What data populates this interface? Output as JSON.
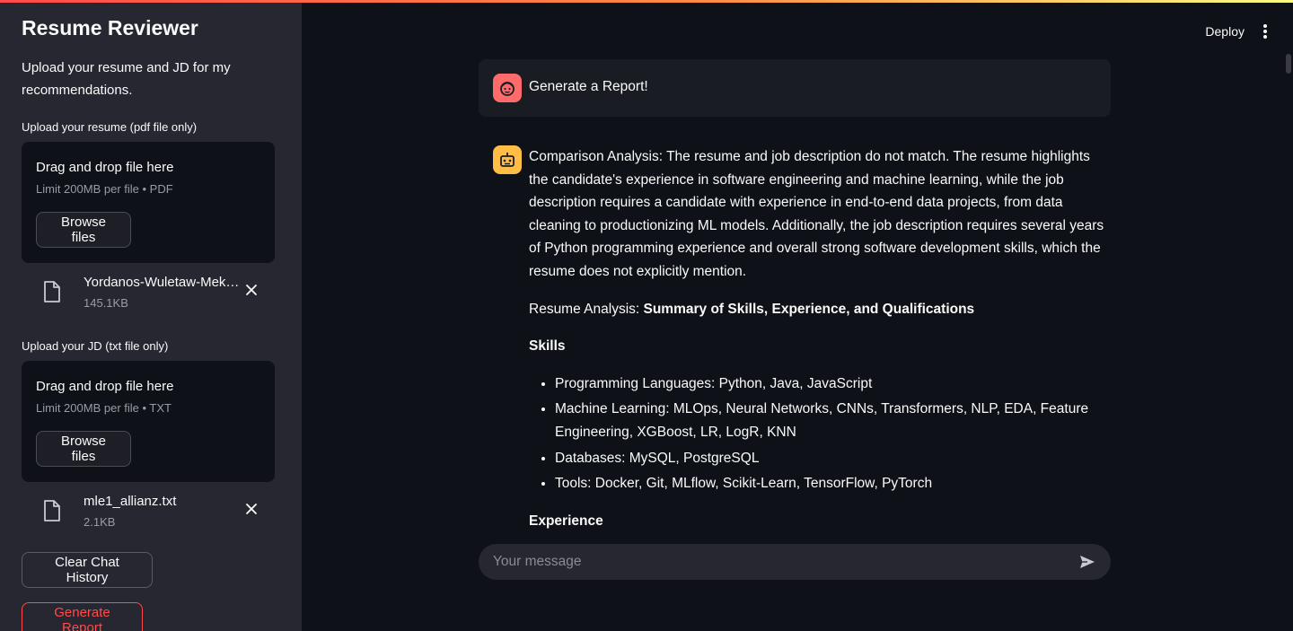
{
  "sidebar": {
    "title": "Resume Reviewer",
    "description": "Upload your resume and JD for my recommendations.",
    "resume_upload": {
      "label": "Upload your resume (pdf file only)",
      "drop_text": "Drag and drop file here",
      "limit_text": "Limit 200MB per file • PDF",
      "browse_label": "Browse files",
      "file": {
        "name": "Yordanos-Wuletaw-Mek…",
        "size": "145.1KB"
      }
    },
    "jd_upload": {
      "label": "Upload your JD (txt file only)",
      "drop_text": "Drag and drop file here",
      "limit_text": "Limit 200MB per file • TXT",
      "browse_label": "Browse files",
      "file": {
        "name": "mle1_allianz.txt",
        "size": "2.1KB"
      }
    },
    "clear_label": "Clear Chat History",
    "generate_label": "Generate Report"
  },
  "header": {
    "deploy_label": "Deploy",
    "menu_icon": "kebab-menu-icon"
  },
  "chat": {
    "user_message": "Generate a Report!",
    "bot_message": {
      "comparison": "Comparison Analysis: The resume and job description do not match. The resume highlights the candidate's experience in software engineering and machine learning, while the job description requires a candidate with experience in end-to-end data projects, from data cleaning to productionizing ML models. Additionally, the job description requires several years of Python programming experience and overall strong software development skills, which the resume does not explicitly mention.",
      "resume_analysis_prefix": "Resume Analysis: ",
      "resume_analysis_title": "Summary of Skills, Experience, and Qualifications",
      "skills_heading": "Skills",
      "skills": [
        "Programming Languages: Python, Java, JavaScript",
        "Machine Learning: MLOps, Neural Networks, CNNs, Transformers, NLP, EDA, Feature Engineering, XGBoost, LR, LogR, KNN",
        "Databases: MySQL, PostgreSQL",
        "Tools: Docker, Git, MLflow, Scikit-Learn, TensorFlow, PyTorch"
      ],
      "experience_heading": "Experience"
    },
    "input_placeholder": "Your message"
  },
  "colors": {
    "background": "#0e1117",
    "sidebar": "#262730",
    "accent": "#ff4b4b",
    "user_avatar": "#ff6b6b",
    "bot_avatar": "#ffbd45"
  }
}
